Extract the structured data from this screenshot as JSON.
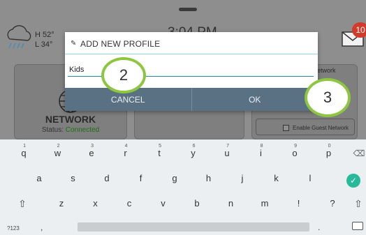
{
  "header": {
    "weather": {
      "high": "H 52°",
      "low": "L 34°",
      "icon": "cloud-rain-icon"
    },
    "time": "3:04 PM",
    "mail": {
      "icon": "mail-icon",
      "badge": "10"
    }
  },
  "cards": {
    "network": {
      "title": "NETWORK",
      "status_label": "Status:",
      "status_value": "Connected",
      "icon": "globe-icon"
    },
    "guest": {
      "label": "etwork",
      "checkbox_label": "Enable Guest Network"
    }
  },
  "dialog": {
    "title": "ADD NEW PROFILE",
    "title_icon": "pencil-icon",
    "input_value": "Kids",
    "cancel": "CANCEL",
    "ok": "OK"
  },
  "callouts": {
    "step2": "2",
    "step3": "3"
  },
  "keyboard": {
    "row1": [
      {
        "k": "q",
        "h": "1"
      },
      {
        "k": "w",
        "h": "2"
      },
      {
        "k": "e",
        "h": "3"
      },
      {
        "k": "r",
        "h": "4"
      },
      {
        "k": "t",
        "h": "5"
      },
      {
        "k": "y",
        "h": "6"
      },
      {
        "k": "u",
        "h": "7"
      },
      {
        "k": "i",
        "h": "8"
      },
      {
        "k": "o",
        "h": "9"
      },
      {
        "k": "p",
        "h": "0"
      }
    ],
    "row2": [
      "a",
      "s",
      "d",
      "f",
      "g",
      "h",
      "j",
      "k",
      "l"
    ],
    "row3": [
      "z",
      "x",
      "c",
      "v",
      "b",
      "n",
      "m",
      "!",
      "?"
    ],
    "sym": "?123",
    "comma": ",",
    "period": ".",
    "backspace_icon": "backspace-icon",
    "enter_icon": "check-icon",
    "shift_icon": "shift-icon",
    "keyboard_icon": "keyboard-icon"
  },
  "colors": {
    "accent_green": "#8dc63f",
    "connected": "#1d6e14",
    "badge": "#d23b2c",
    "enter": "#26b99a",
    "dialog_buttons": "#5a7184"
  }
}
